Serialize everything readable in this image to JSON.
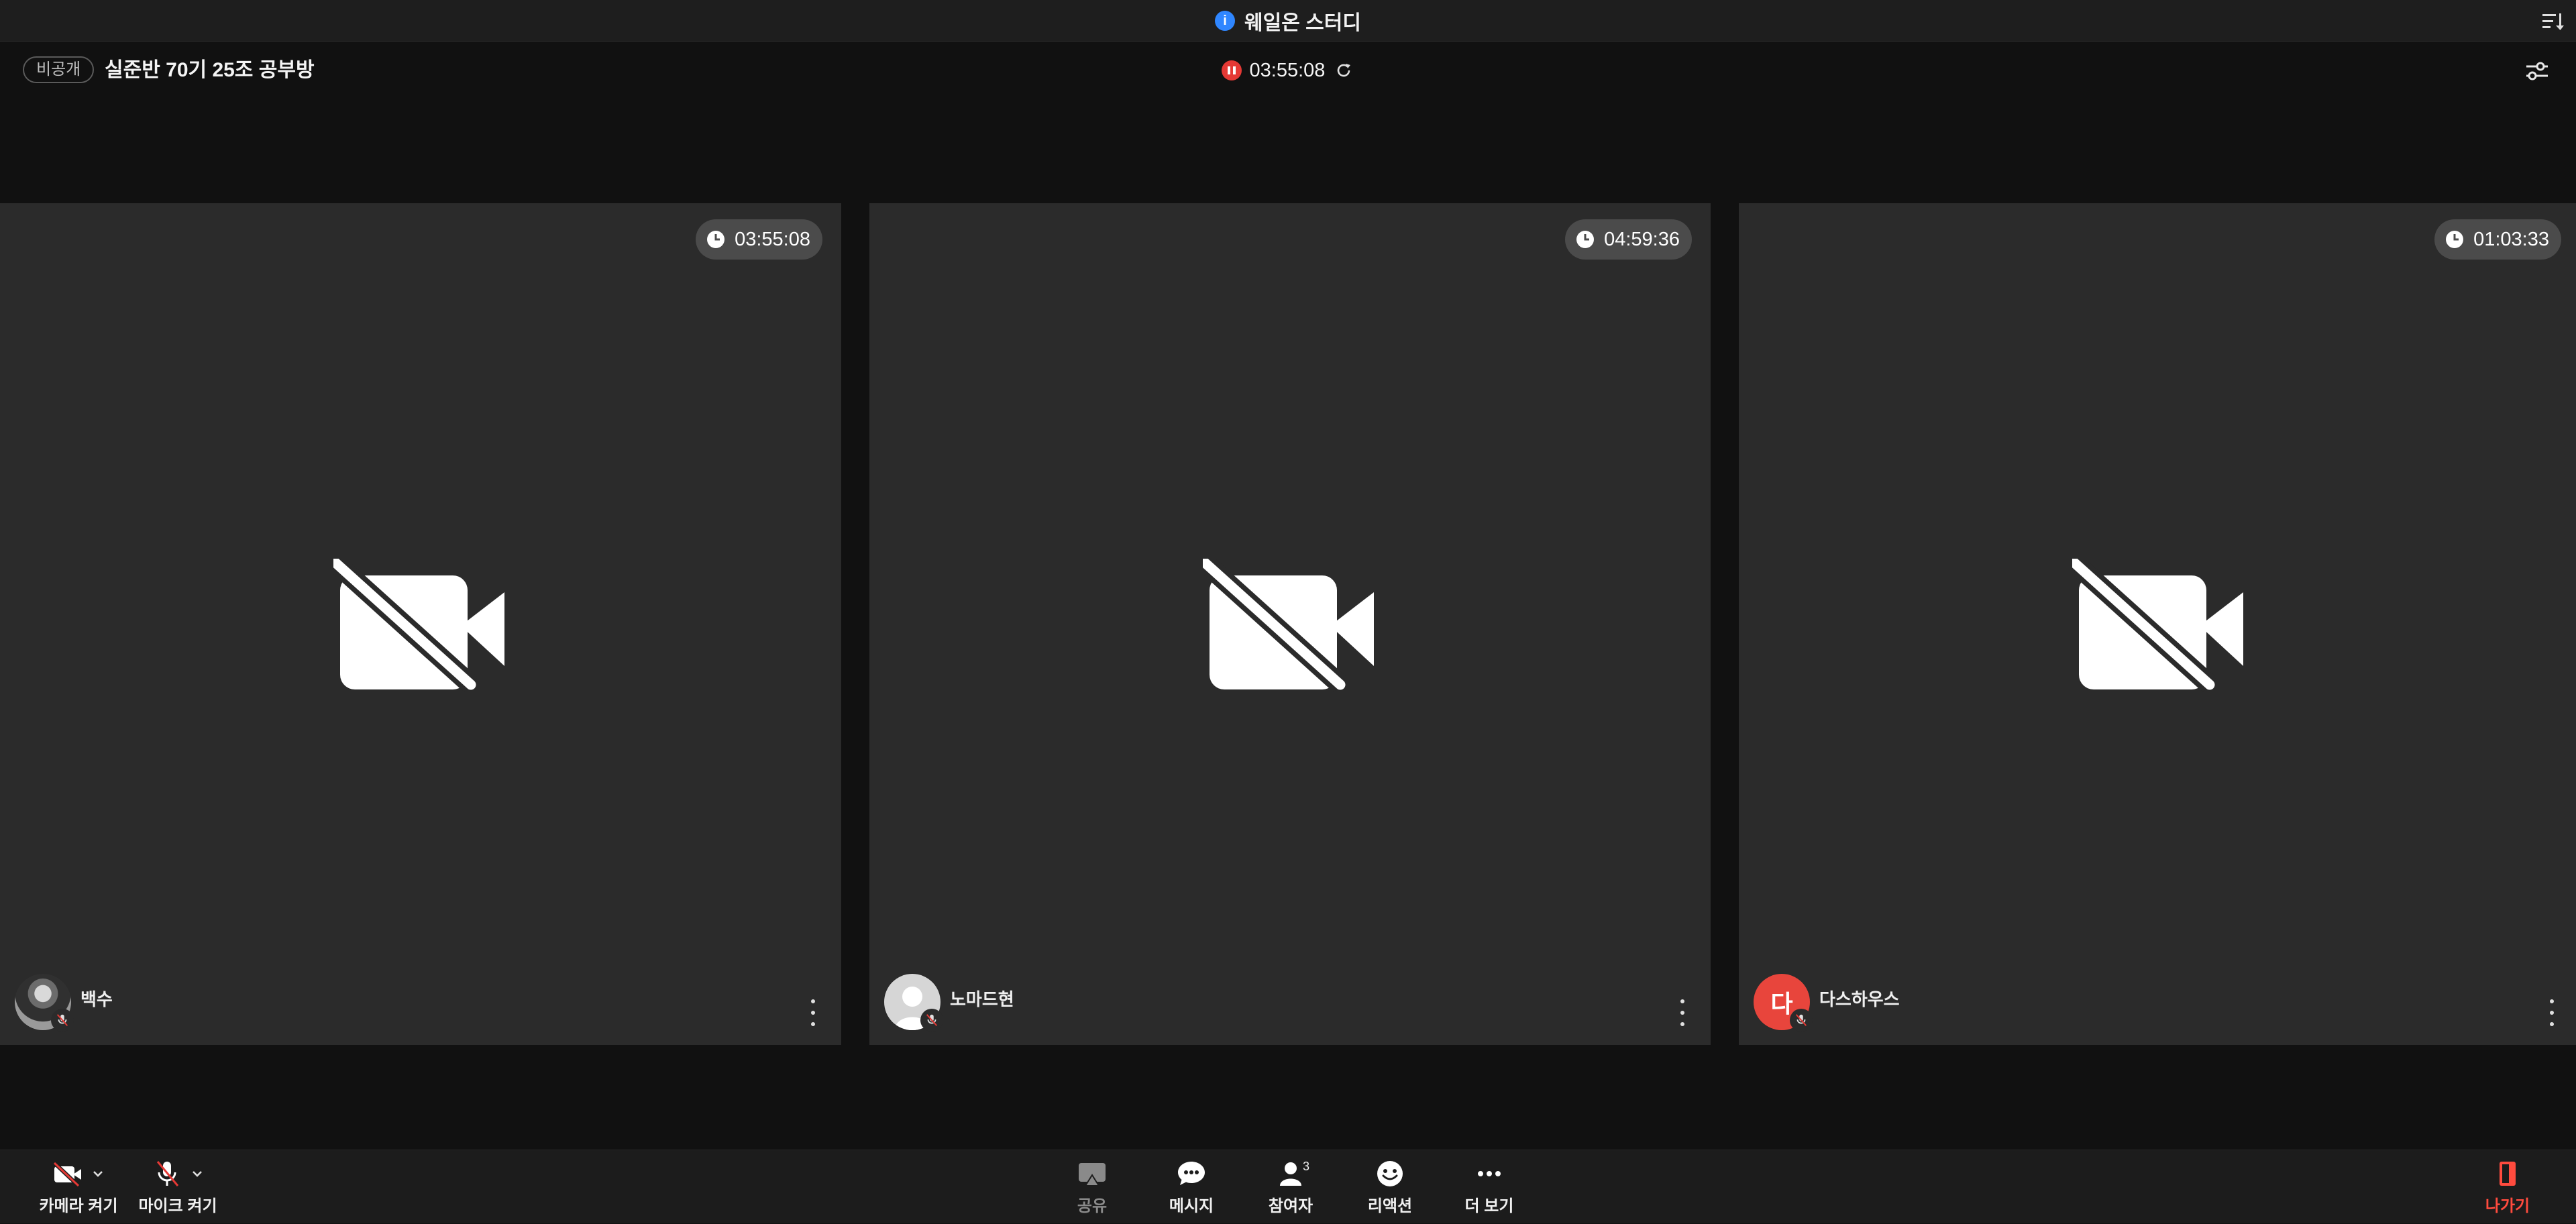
{
  "window": {
    "title": "웨일온 스터디"
  },
  "room": {
    "privacy_badge": "비공개",
    "title": "실준반 70기 25조 공부방",
    "timer": "03:55:08"
  },
  "participants": [
    {
      "name": "백수",
      "timer": "03:55:08",
      "avatar": "photo",
      "mic_muted": true,
      "camera_off": true
    },
    {
      "name": "노마드현",
      "timer": "04:59:36",
      "avatar": "default-person",
      "mic_muted": true,
      "camera_off": true
    },
    {
      "name": "다스하우스",
      "timer": "01:03:33",
      "avatar_letter": "다",
      "avatar_color": "#e8453c",
      "mic_muted": true,
      "camera_off": true
    }
  ],
  "toolbar": {
    "camera_label": "카메라 켜기",
    "mic_label": "마이크 켜기",
    "share_label": "공유",
    "message_label": "메시지",
    "participants_label": "참여자",
    "participants_count": "3",
    "reaction_label": "리액션",
    "more_label": "더 보기",
    "leave_label": "나가기"
  },
  "colors": {
    "background": "#111111",
    "tile": "#2b2b2b",
    "accent_blue": "#2f86ff",
    "record_red": "#e53935",
    "leave_red": "#ff4b3e"
  }
}
